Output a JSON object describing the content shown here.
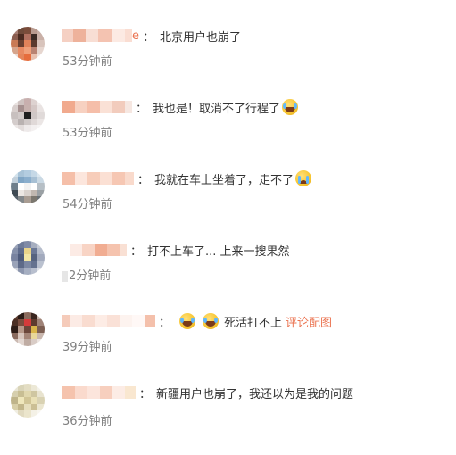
{
  "colors": {
    "text": "#333333",
    "time": "#808080",
    "link": "#eb7350"
  },
  "comments": [
    {
      "name_suffix": "e",
      "colon": "：",
      "text": "北京用户也崩了",
      "time": "53分钟前",
      "avatar_icon": "user-avatar"
    },
    {
      "name_suffix": "",
      "colon": "：",
      "text": "我也是！取消不了行程了",
      "emoji": "laugh-cry-emoji",
      "time": "53分钟前",
      "avatar_icon": "user-avatar"
    },
    {
      "name_suffix": "",
      "colon": "：",
      "text": "我就在车上坐着了，走不了",
      "emoji": "crying-emoji",
      "time": "54分钟前",
      "avatar_icon": "user-avatar"
    },
    {
      "name_suffix": "",
      "colon": "：",
      "text": "打不上车了... 上来一搜果然",
      "time": "2分钟前",
      "avatar_icon": "user-avatar"
    },
    {
      "name_suffix": "",
      "colon": "：",
      "text": "死活打不上",
      "emoji": "laugh-cry-emoji",
      "link": "评论配图",
      "time": "39分钟前",
      "avatar_icon": "user-avatar"
    },
    {
      "name_suffix": "",
      "colon": "：",
      "text": "新疆用户也崩了，我还以为是我的问题",
      "time": "36分钟前",
      "avatar_icon": "user-avatar"
    }
  ]
}
